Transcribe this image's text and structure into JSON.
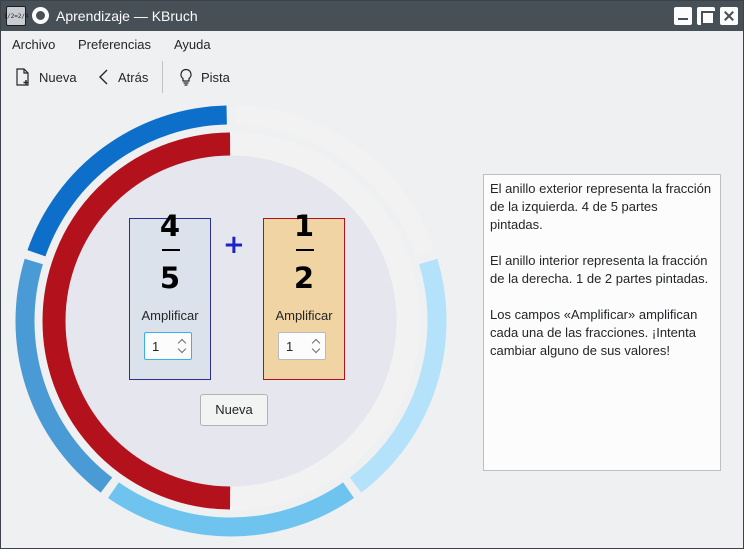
{
  "window": {
    "title": "Aprendizaje — KBruch",
    "app_icon_text": "1/2=2/4"
  },
  "menubar": {
    "items": [
      "Archivo",
      "Preferencias",
      "Ayuda"
    ]
  },
  "toolbar": {
    "new_label": "Nueva",
    "back_label": "Atrás",
    "hint_label": "Pista"
  },
  "exercise": {
    "left": {
      "numerator": "4",
      "denominator": "5",
      "expand_label": "Amplificar",
      "expand_value": "1",
      "segments": 5,
      "filled": 4,
      "color": "#0d6fc9"
    },
    "operator": "+",
    "right": {
      "numerator": "1",
      "denominator": "2",
      "expand_label": "Amplificar",
      "expand_value": "1",
      "segments": 2,
      "filled": 1,
      "color": "#b3121d"
    },
    "new_button": "Nueva"
  },
  "info": {
    "paragraphs": [
      "El anillo exterior representa la fracción de la izquierda. 4 de 5 partes pintadas.",
      "El anillo interior representa la fracción de la derecha. 1 de 2 partes pintadas.",
      "Los campos «Amplificar» amplifican cada una de las fracciones. ¡Intenta cambiar alguno de sus valores!"
    ]
  },
  "colors": {
    "outer_unfilled_light": "#b4e2fb",
    "outer_unfilled_mid": "#6fc4ef",
    "outer_unfilled_blue": "#4a9ad6",
    "empty": "#f2f2f2",
    "inner_bg": "#e6e6ee"
  }
}
